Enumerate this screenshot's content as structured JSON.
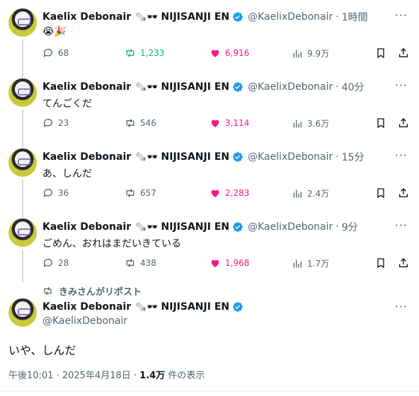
{
  "author": {
    "name": "Kaelix Debonair",
    "emoji": "🗞️🕶️",
    "org": "NIJISANJI EN",
    "handle": "@KaelixDebonair"
  },
  "thread": [
    {
      "time": "1時間",
      "text": "😭🎉",
      "replies": "68",
      "reposts": "1,233",
      "likes": "6,916",
      "views": "9.9万",
      "reposted": true
    },
    {
      "time": "40分",
      "text": "てんごくだ",
      "replies": "23",
      "reposts": "546",
      "likes": "3,114",
      "views": "3.6万",
      "reposted": false
    },
    {
      "time": "15分",
      "text": "あ、しんだ",
      "replies": "36",
      "reposts": "657",
      "likes": "2,283",
      "views": "2.4万",
      "reposted": false
    },
    {
      "time": "9分",
      "text": "ごめん、おれはまだいきている",
      "replies": "28",
      "reposts": "438",
      "likes": "1,968",
      "views": "1.7万",
      "reposted": false
    }
  ],
  "repost_label": "きみさんがリポスト",
  "main": {
    "text": "いや、しんだ",
    "timestamp": "午後10:01 · 2025年4月18日 · ",
    "views_count": "1.4万",
    "views_suffix": " 件の表示"
  },
  "colors": {
    "verified": "#1d9bf0",
    "like": "#f91880",
    "repost_active": "#00ba7c",
    "muted": "#536471"
  }
}
